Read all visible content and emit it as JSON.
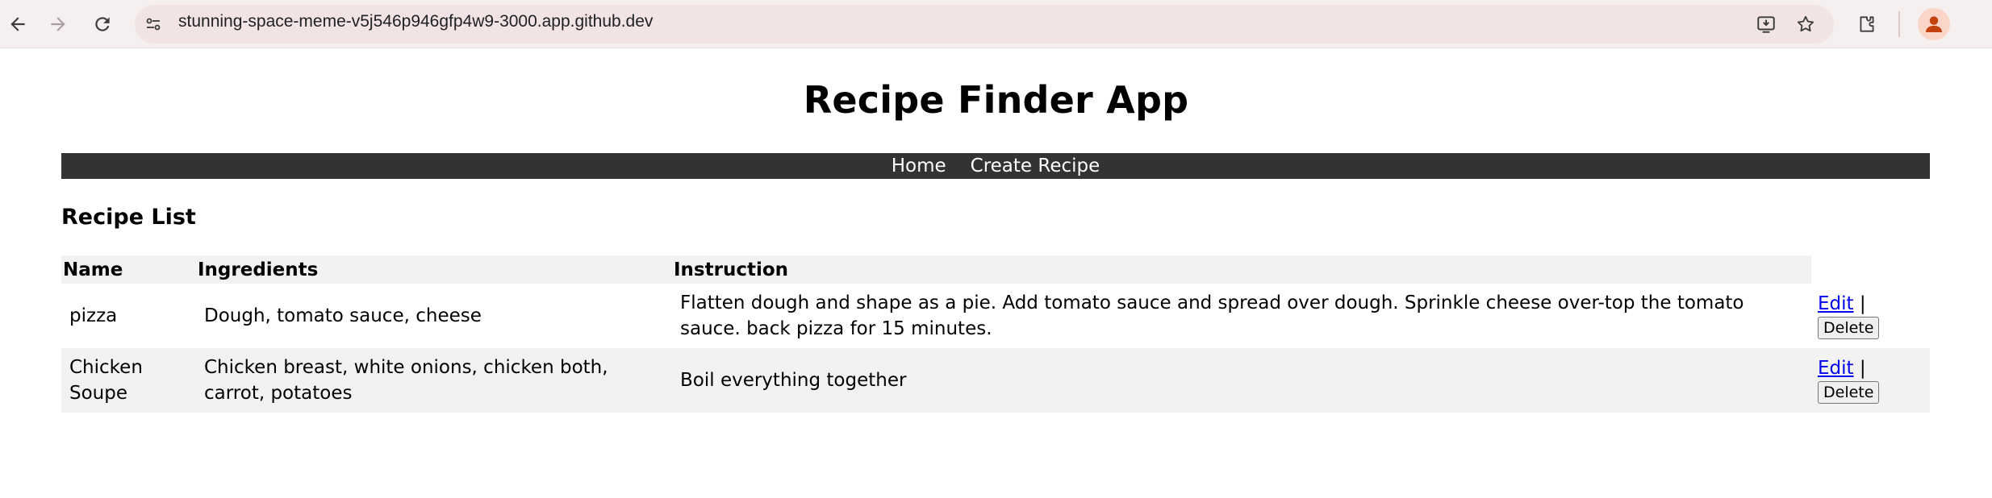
{
  "browser": {
    "url": "stunning-space-meme-v5j546p946gfp4w9-3000.app.github.dev",
    "icons": [
      "back-icon",
      "forward-icon",
      "reload-icon",
      "site-info-icon",
      "install-app-icon",
      "bookmark-star-icon",
      "extensions-icon",
      "profile-avatar-icon"
    ]
  },
  "app": {
    "title": "Recipe Finder App"
  },
  "nav": {
    "home": "Home",
    "create": "Create Recipe"
  },
  "recipe_list": {
    "heading": "Recipe List",
    "columns": {
      "name": "Name",
      "ingredients": "Ingredients",
      "instruction": "Instruction"
    },
    "rows": [
      {
        "name": "pizza",
        "ingredients": "Dough, tomato sauce, cheese",
        "instruction": "Flatten dough and shape as a pie. Add tomato sauce and spread over dough. Sprinkle cheese over-top the tomato sauce. back pizza for 15 minutes.",
        "edit": "Edit",
        "separator": "|",
        "delete": "Delete"
      },
      {
        "name": "Chicken Soupe",
        "ingredients": "Chicken breast, white onions, chicken both, carrot, potatoes",
        "instruction": "Boil everything together",
        "edit": "Edit",
        "separator": "|",
        "delete": "Delete"
      }
    ]
  },
  "colors": {
    "navbar_bg": "#333333",
    "stripe_bg": "#f2f2f2",
    "link": "#0000ee",
    "chrome_bg": "#f6eff0"
  }
}
